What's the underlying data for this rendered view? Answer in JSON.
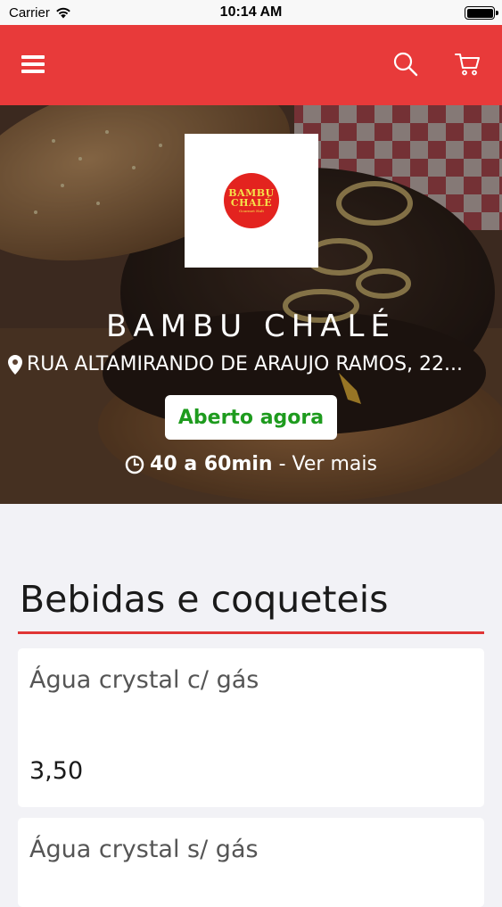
{
  "status_bar": {
    "carrier": "Carrier",
    "time": "10:14 AM"
  },
  "navbar": {
    "menu_icon": "menu-icon",
    "search_icon": "search-icon",
    "cart_icon": "cart-icon",
    "color": "#e83a3a"
  },
  "store": {
    "logo": {
      "line1": "BAMBU",
      "line2": "CHALÉ",
      "line3": "Gourmet Halt"
    },
    "name": "BAMBU CHALÉ",
    "address": "RUA ALTAMIRANDO DE ARAUJO RAMOS, 22...",
    "status": "Aberto agora",
    "delivery_time": "40 a 60min",
    "separator": " - ",
    "see_more": "Ver mais"
  },
  "menu": {
    "section_title": "Bebidas e coqueteis",
    "items": [
      {
        "name": "Água crystal c/ gás",
        "price": "3,50"
      },
      {
        "name": "Água crystal s/ gás",
        "price": ""
      }
    ]
  }
}
